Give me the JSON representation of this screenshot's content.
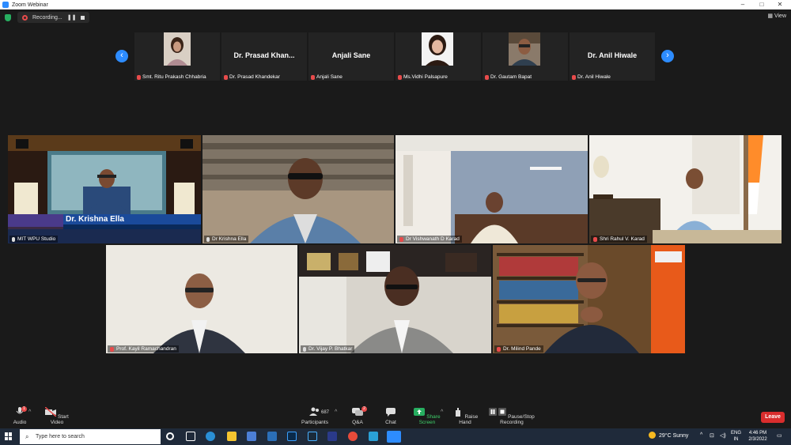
{
  "window": {
    "title": "Zoom Webinar"
  },
  "topbar": {
    "recording_label": "Recording...",
    "view_label": "View"
  },
  "strip": [
    {
      "label": "Smt. Ritu Prakash Chhabria",
      "big": ""
    },
    {
      "label": "Dr. Prasad Khandekar",
      "big": "Dr. Prasad Khan..."
    },
    {
      "label": "Anjali Sane",
      "big": "Anjali Sane"
    },
    {
      "label": "Ms.Vidhi Palsapure",
      "big": ""
    },
    {
      "label": "Dr. Gautam Bapat",
      "big": ""
    },
    {
      "label": "Dr. Anil Hiwale",
      "big": "Dr. Anil Hiwale"
    }
  ],
  "grid": [
    {
      "label": "MIT WPU Studio",
      "overlay_name": "Dr. Krishna Ella"
    },
    {
      "label": "Dr Krishna Ella"
    },
    {
      "label": "Dr Vishwanath D Karad"
    },
    {
      "label": "Shri Rahul V. Karad"
    },
    {
      "label": "Prof. Kayil Ramachandran"
    },
    {
      "label": "Dr. Vijay P. Bhatkar"
    },
    {
      "label": "Dr. Milind Pande"
    }
  ],
  "toolbar": {
    "audio": "Audio",
    "video": "Start Video",
    "participants": "Participants",
    "participants_count": "687",
    "qa": "Q&A",
    "qa_badge": "2",
    "chat": "Chat",
    "share": "Share Screen",
    "raise": "Raise Hand",
    "recording": "Pause/Stop Recording",
    "leave": "Leave",
    "audio_badge": "1"
  },
  "taskbar": {
    "search_placeholder": "Type here to search",
    "weather": "29°C  Sunny",
    "lang1": "ENG",
    "lang2": "IN",
    "time": "4:46 PM",
    "date": "2/3/2022"
  },
  "colors": {
    "accent": "#2d8cff",
    "active_speaker": "#f0d43a",
    "leave": "#d92d2d"
  }
}
